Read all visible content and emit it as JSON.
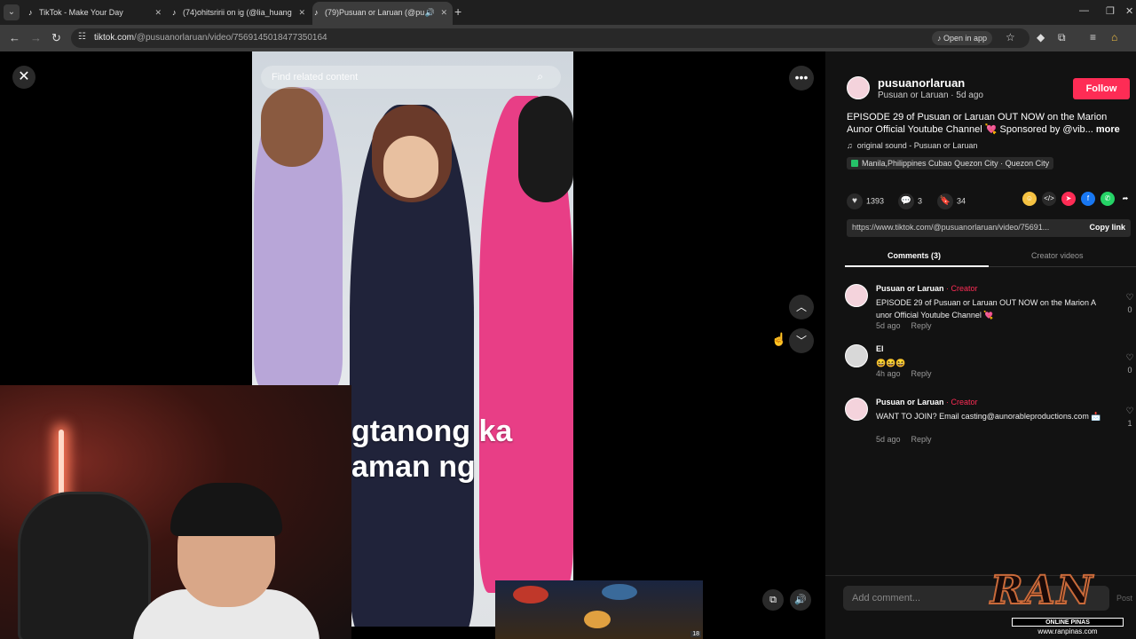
{
  "browser": {
    "tabs": [
      {
        "label": "TikTok - Make Your Day",
        "active": false
      },
      {
        "label": "(74)ohitsririi on ig (@lia_huang",
        "active": false
      },
      {
        "label": "(79)Pusuan or Laruan (@pu",
        "active": true
      }
    ],
    "url_host": "tiktok.com",
    "url_path": "/@pusuanorlaruan/video/7569145018477350164",
    "open_in_app": "Open in app"
  },
  "video": {
    "search_placeholder": "Find related content",
    "caption_line1": "gtanong ka",
    "caption_line2": "aman ng"
  },
  "panel": {
    "username": "pusuanorlaruan",
    "subline": "Pusuan or Laruan · 5d ago",
    "follow_label": "Follow",
    "description": "EPISODE 29 of Pusuan or Laruan OUT NOW on the Marion Aunor Official Youtube Channel 💘 Sponsored by @vib...",
    "more_label": "more",
    "sound": "original sound - Pusuan or Laruan",
    "location": "Manila,Philippines Cubao Quezon City · Quezon City",
    "likes": "1393",
    "comments": "3",
    "saves": "34",
    "link": "https://www.tiktok.com/@pusuanorlaruan/video/75691...",
    "copy_link": "Copy link",
    "tab_comments": "Comments (3)",
    "tab_creator": "Creator videos",
    "add_comment_placeholder": "Add comment...",
    "post_label": "Post"
  },
  "comments": [
    {
      "author": "Pusuan or Laruan",
      "creator_tag": " · Creator",
      "text": "EPISODE 29 of Pusuan or Laruan OUT NOW on the Marion A unor Official Youtube Channel 💘",
      "age": "5d ago",
      "reply": "Reply",
      "likes": "0"
    },
    {
      "author": "El",
      "creator_tag": "",
      "text": "😆😆😆",
      "age": "4h ago",
      "reply": "Reply",
      "likes": "0"
    },
    {
      "author": "Pusuan or Laruan",
      "creator_tag": " · Creator",
      "text": "WANT TO JOIN? Email casting@aunorableproductions.com 📩",
      "age": "5d ago",
      "reply": "Reply",
      "likes": "1"
    }
  ],
  "watermark": {
    "brand": "RAN",
    "strip": "ONLINE PINAS",
    "site": "www.ranpinas.com"
  },
  "game_badge": "18",
  "colors": {
    "accent": "#fe2c55",
    "panel_bg": "#121212",
    "page_bg": "#000000"
  }
}
